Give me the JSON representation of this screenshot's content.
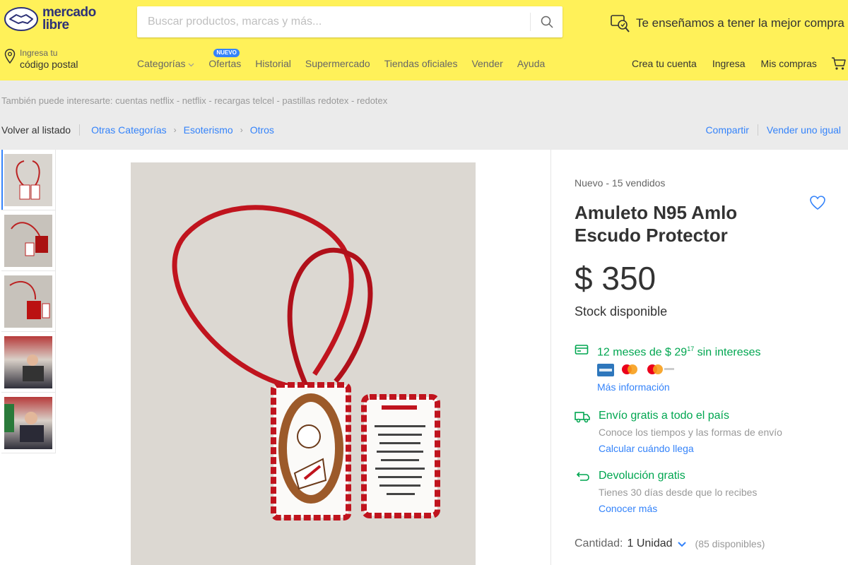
{
  "header": {
    "logo_line1": "mercado",
    "logo_line2": "libre",
    "search_placeholder": "Buscar productos, marcas y más...",
    "promo_text": "Te enseñamos a tener la mejor compra",
    "location_small": "Ingresa tu",
    "location_big": "código postal",
    "nav": [
      {
        "label": "Categorías"
      },
      {
        "label": "Ofertas",
        "badge": "NUEVO"
      },
      {
        "label": "Historial"
      },
      {
        "label": "Supermercado"
      },
      {
        "label": "Tiendas oficiales"
      },
      {
        "label": "Vender"
      },
      {
        "label": "Ayuda"
      }
    ],
    "user_nav": [
      "Crea tu cuenta",
      "Ingresa",
      "Mis compras"
    ]
  },
  "related": "También puede interesarte: cuentas netflix - netflix - recargas telcel - pastillas redotex - redotex",
  "breadcrumb": {
    "back": "Volver al listado",
    "items": [
      "Otras Categorías",
      "Esoterismo",
      "Otros"
    ]
  },
  "actions": {
    "share": "Compartir",
    "sell_same": "Vender uno igual"
  },
  "product": {
    "condition": "Nuevo  -  15 vendidos",
    "title": "Amuleto N95 Amlo Escudo Protector",
    "price": "$ 350",
    "stock": "Stock disponible",
    "installments_prefix": "12 meses de $ 29",
    "installments_cents": "17",
    "installments_suffix": " sin intereses",
    "more_info": "Más información",
    "shipping_title": "Envío gratis a todo el país",
    "shipping_sub": "Conoce los tiempos y las formas de envío",
    "shipping_link": "Calcular cuándo llega",
    "return_title": "Devolución gratis",
    "return_sub": "Tienes 30 días desde que lo recibes",
    "return_link": "Conocer más",
    "quantity_label": "Cantidad:",
    "quantity_value": "1 Unidad",
    "quantity_available": "(85 disponibles)"
  },
  "colors": {
    "header_bg": "#fff159",
    "link": "#3483fa",
    "success": "#00a650"
  }
}
